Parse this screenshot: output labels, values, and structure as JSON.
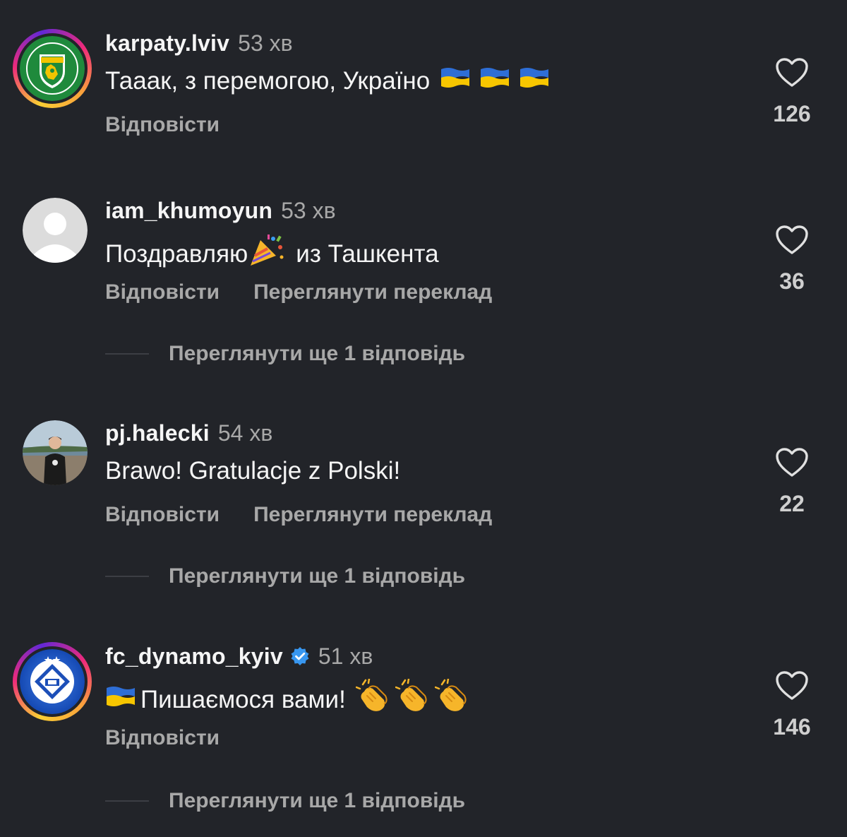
{
  "comments": [
    {
      "username": "karpaty.lviv",
      "time": "53 хв",
      "text": "Тааак, з перемогою, Україно",
      "text_emoji": [
        "ukraine-flag",
        "ukraine-flag",
        "ukraine-flag"
      ],
      "actions": [
        "Відповісти"
      ],
      "likes": "126",
      "avatar": "karpaty-club-logo",
      "story_ring": true
    },
    {
      "username": "iam_khumoyun",
      "time": "53 хв",
      "text_before": "Поздравляю",
      "text_emoji": [
        "party-popper"
      ],
      "text_after": "из Ташкента",
      "actions": [
        "Відповісти",
        "Переглянути переклад"
      ],
      "likes": "36",
      "avatar": "default-avatar",
      "more_replies": "Переглянути ще 1 відповідь"
    },
    {
      "username": "pj.halecki",
      "time": "54 хв",
      "text": "Brawo! Gratulacje z Polski!",
      "actions": [
        "Відповісти",
        "Переглянути переклад"
      ],
      "likes": "22",
      "avatar": "photo-avatar",
      "more_replies": "Переглянути ще 1 відповідь"
    },
    {
      "username": "fc_dynamo_kyiv",
      "verified": true,
      "time": "51 хв",
      "text_prefix_emoji": "ukraine-flag",
      "text": "Пишаємося вами!",
      "text_emoji": [
        "clapping-hands",
        "clapping-hands",
        "clapping-hands"
      ],
      "actions": [
        "Відповісти"
      ],
      "likes": "146",
      "avatar": "dynamo-club-logo",
      "story_ring": true,
      "more_replies": "Переглянути ще 1 відповідь"
    }
  ],
  "colors": {
    "background": "#222429",
    "text": "#f5f5f5",
    "secondary": "#a8a8a8",
    "verified": "#3897f0"
  }
}
